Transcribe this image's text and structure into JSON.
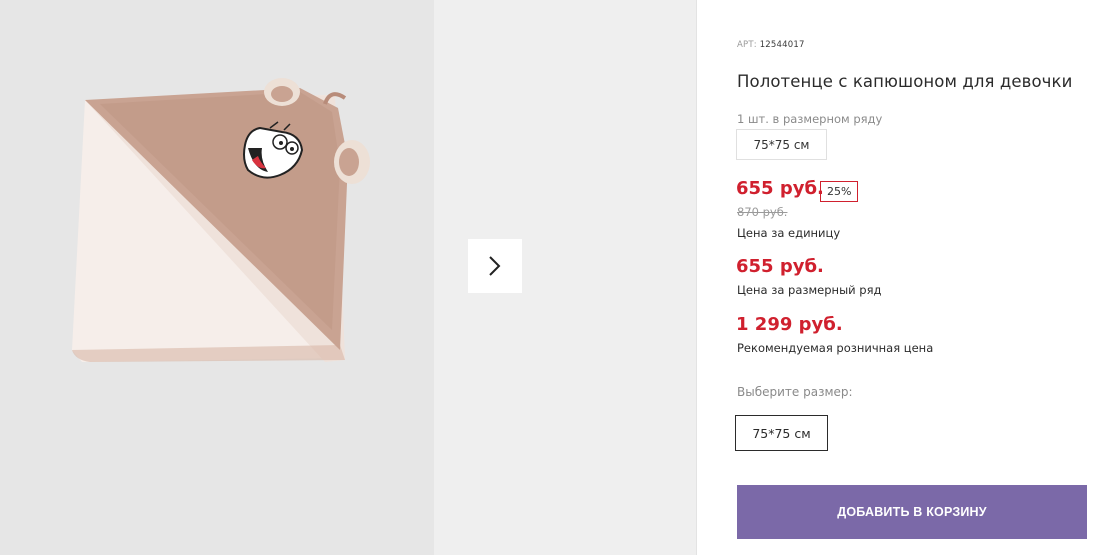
{
  "gallery": {
    "image_alt": "towel-with-hood-photo",
    "next_icon": "chevron-right-icon"
  },
  "product": {
    "art_label": "АРТ:",
    "art_number": "12544017",
    "title": "Полотенце с капюшоном для девочки",
    "qty_note": "1 шт. в размерном ряду",
    "size_in_row": "75*75 см",
    "price_unit": "655 руб.",
    "discount": "25%",
    "old_price": "870 руб.",
    "price_unit_label": "Цена за единицу",
    "price_row": "655 руб.",
    "price_row_label": "Цена за размерный ряд",
    "price_retail": "1 299 руб.",
    "price_retail_label": "Рекомендуемая розничная цена",
    "choose_size_label": "Выберите размер:",
    "selected_size": "75*75 см",
    "add_to_cart": "ДОБАВИТЬ В КОРЗИНУ"
  },
  "colors": {
    "accent": "#7b69a8",
    "price_red": "#d0202e"
  }
}
